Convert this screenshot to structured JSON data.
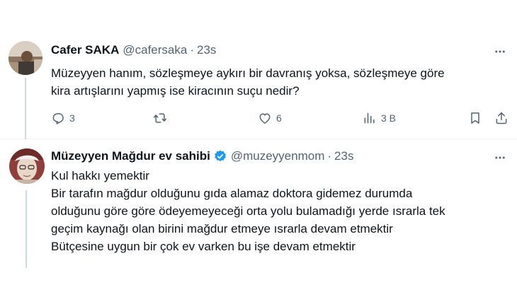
{
  "tweets": [
    {
      "author": {
        "name": "Cafer SAKA",
        "handle": "@cafersaka"
      },
      "separator": "·",
      "time": "23s",
      "lines": [
        "Müzeyyen hanım, sözleşmeye aykırı bir davranış yoksa, sözleşmeye göre",
        "kira artışlarını yapmış ise kiracının suçu nedir?"
      ],
      "actions": {
        "replies": "3",
        "retweets": "",
        "likes": "6",
        "views": "3 B"
      },
      "icons": [
        "more-icon",
        "reply-icon",
        "retweet-icon",
        "like-icon",
        "views-icon",
        "bookmark-icon",
        "share-icon"
      ]
    },
    {
      "author": {
        "name": "Müzeyyen Mağdur ev sahibi",
        "handle": "@muzeyyenmom"
      },
      "separator": "·",
      "time": "23s",
      "verified": true,
      "lines": [
        "Kul hakkı yemektir",
        "Bir tarafın mağdur olduğunu gıda alamaz doktora gidemez durumda",
        "olduğunu göre göre ödeyemeyeceği orta yolu bulamadığı yerde ısrarla tek",
        "geçim kaynağı olan birini mağdur etmeye ısrarla devam etmektir",
        "Bütçesine uygun bir çok ev varken bu işe devam etmektir"
      ],
      "icons": [
        "more-icon",
        "verified-badge-icon"
      ]
    }
  ],
  "colors": {
    "text": "#0f1419",
    "secondary": "#536471",
    "verified": "#1d9bf0",
    "divider": "#eff3f4"
  }
}
